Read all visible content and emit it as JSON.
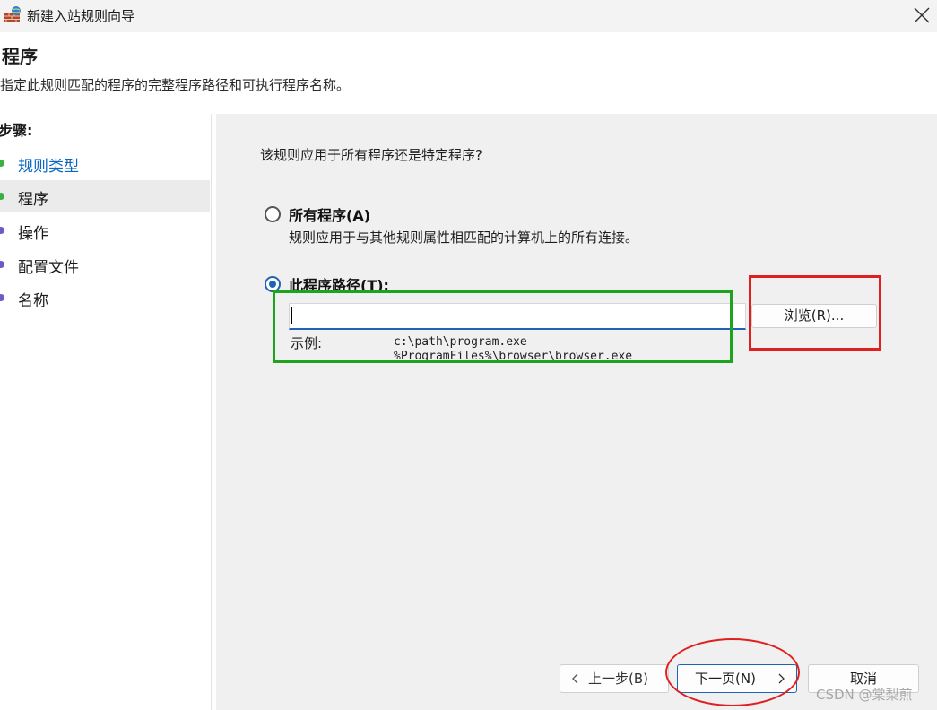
{
  "window": {
    "title": "新建入站规则向导",
    "app_icon": "firewall-icon",
    "close_icon": "close-icon"
  },
  "header": {
    "title": "程序",
    "description": "指定此规则匹配的程序的完整程序路径和可执行程序名称。"
  },
  "sidebar": {
    "steps_label": "步骤:",
    "items": [
      {
        "label": "规则类型",
        "state": "done",
        "color": "#0b66c3"
      },
      {
        "label": "程序",
        "state": "current",
        "color": "#1a1a1a"
      },
      {
        "label": "操作",
        "state": "pending",
        "color": "#1a1a1a"
      },
      {
        "label": "配置文件",
        "state": "pending",
        "color": "#1a1a1a"
      },
      {
        "label": "名称",
        "state": "pending",
        "color": "#1a1a1a"
      }
    ],
    "dot_colors": {
      "done": "#3cb043",
      "pending": "#6a5acd"
    }
  },
  "main": {
    "question": "该规则应用于所有程序还是特定程序?",
    "option_all": {
      "label": "所有程序(A)",
      "description": "规则应用于与其他规则属性相匹配的计算机上的所有连接。",
      "selected": false
    },
    "option_path": {
      "label": "此程序路径(T):",
      "selected": true
    },
    "path_input": {
      "value": ""
    },
    "browse_button": "浏览(R)...",
    "example": {
      "label": "示例:",
      "lines": [
        "c:\\path\\program.exe",
        "%ProgramFiles%\\browser\\browser.exe"
      ]
    }
  },
  "footer": {
    "back_button": "上一步(B)",
    "next_button": "下一页(N)",
    "cancel_button": "取消"
  },
  "watermark": "CSDN @棠梨煎",
  "colors": {
    "accent": "#1f63b4",
    "annotation_red": "#e02020",
    "annotation_green": "#1fa31f"
  }
}
